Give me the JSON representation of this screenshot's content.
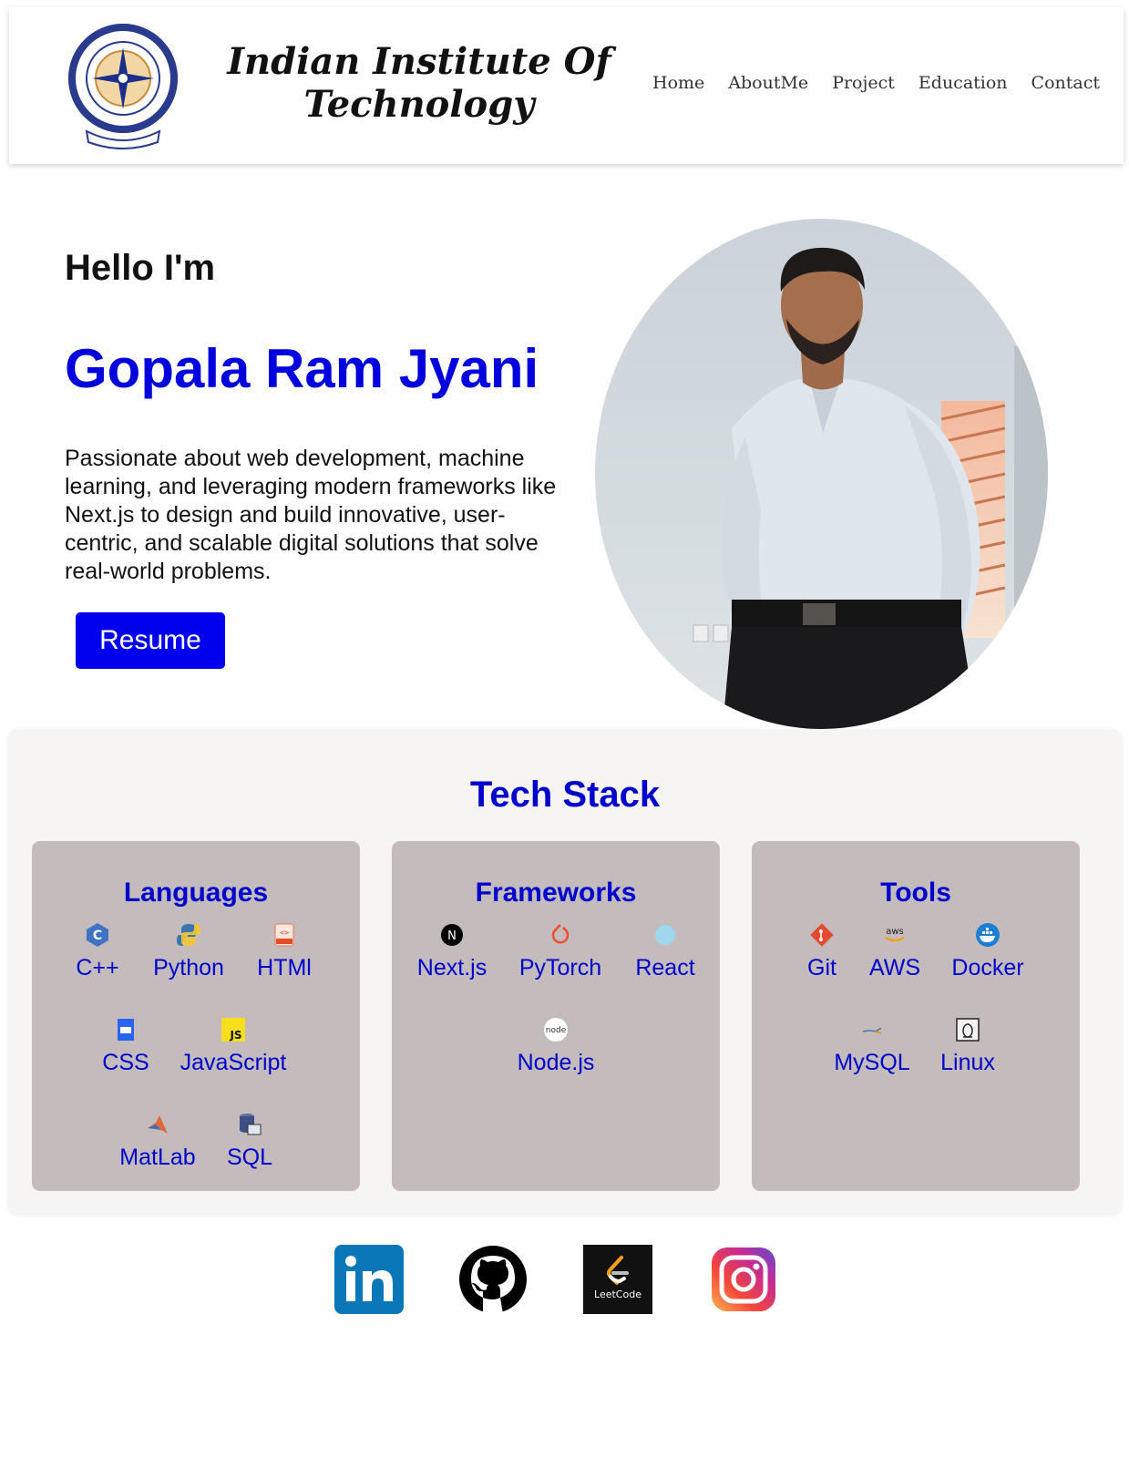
{
  "header": {
    "institute_name": "Indian Institute Of Technology",
    "nav": [
      "Home",
      "AboutMe",
      "Project",
      "Education",
      "Contact"
    ]
  },
  "hero": {
    "greeting": "Hello I'm",
    "name": "Gopala Ram Jyani",
    "bio": "Passionate about web development, machine learning, and leveraging modern frameworks like Next.js to design and build innovative, user-centric, and scalable digital solutions that solve real-world problems.",
    "resume_label": "Resume"
  },
  "tech_stack": {
    "title": "Tech Stack",
    "languages": {
      "title": "Languages",
      "items": [
        "C++",
        "Python",
        "HTMl",
        "CSS",
        "JavaScript",
        "MatLab",
        "SQL"
      ]
    },
    "frameworks": {
      "title": "Frameworks",
      "items": [
        "Next.js",
        "PyTorch",
        "React",
        "Node.js"
      ]
    },
    "tools": {
      "title": "Tools",
      "items": [
        "Git",
        "AWS",
        "Docker",
        "MySQL",
        "Linux"
      ]
    }
  },
  "socials": [
    "linkedin-icon",
    "github-icon",
    "leetcode-icon",
    "instagram-icon"
  ],
  "icon_text": {
    "leetcode": "LeetCode",
    "aws": "aws",
    "js": "JS",
    "node": "node"
  },
  "colors": {
    "accent": "#0000dd",
    "card_bg": "#c4bbbc",
    "panel_bg": "#f6f5f4"
  }
}
